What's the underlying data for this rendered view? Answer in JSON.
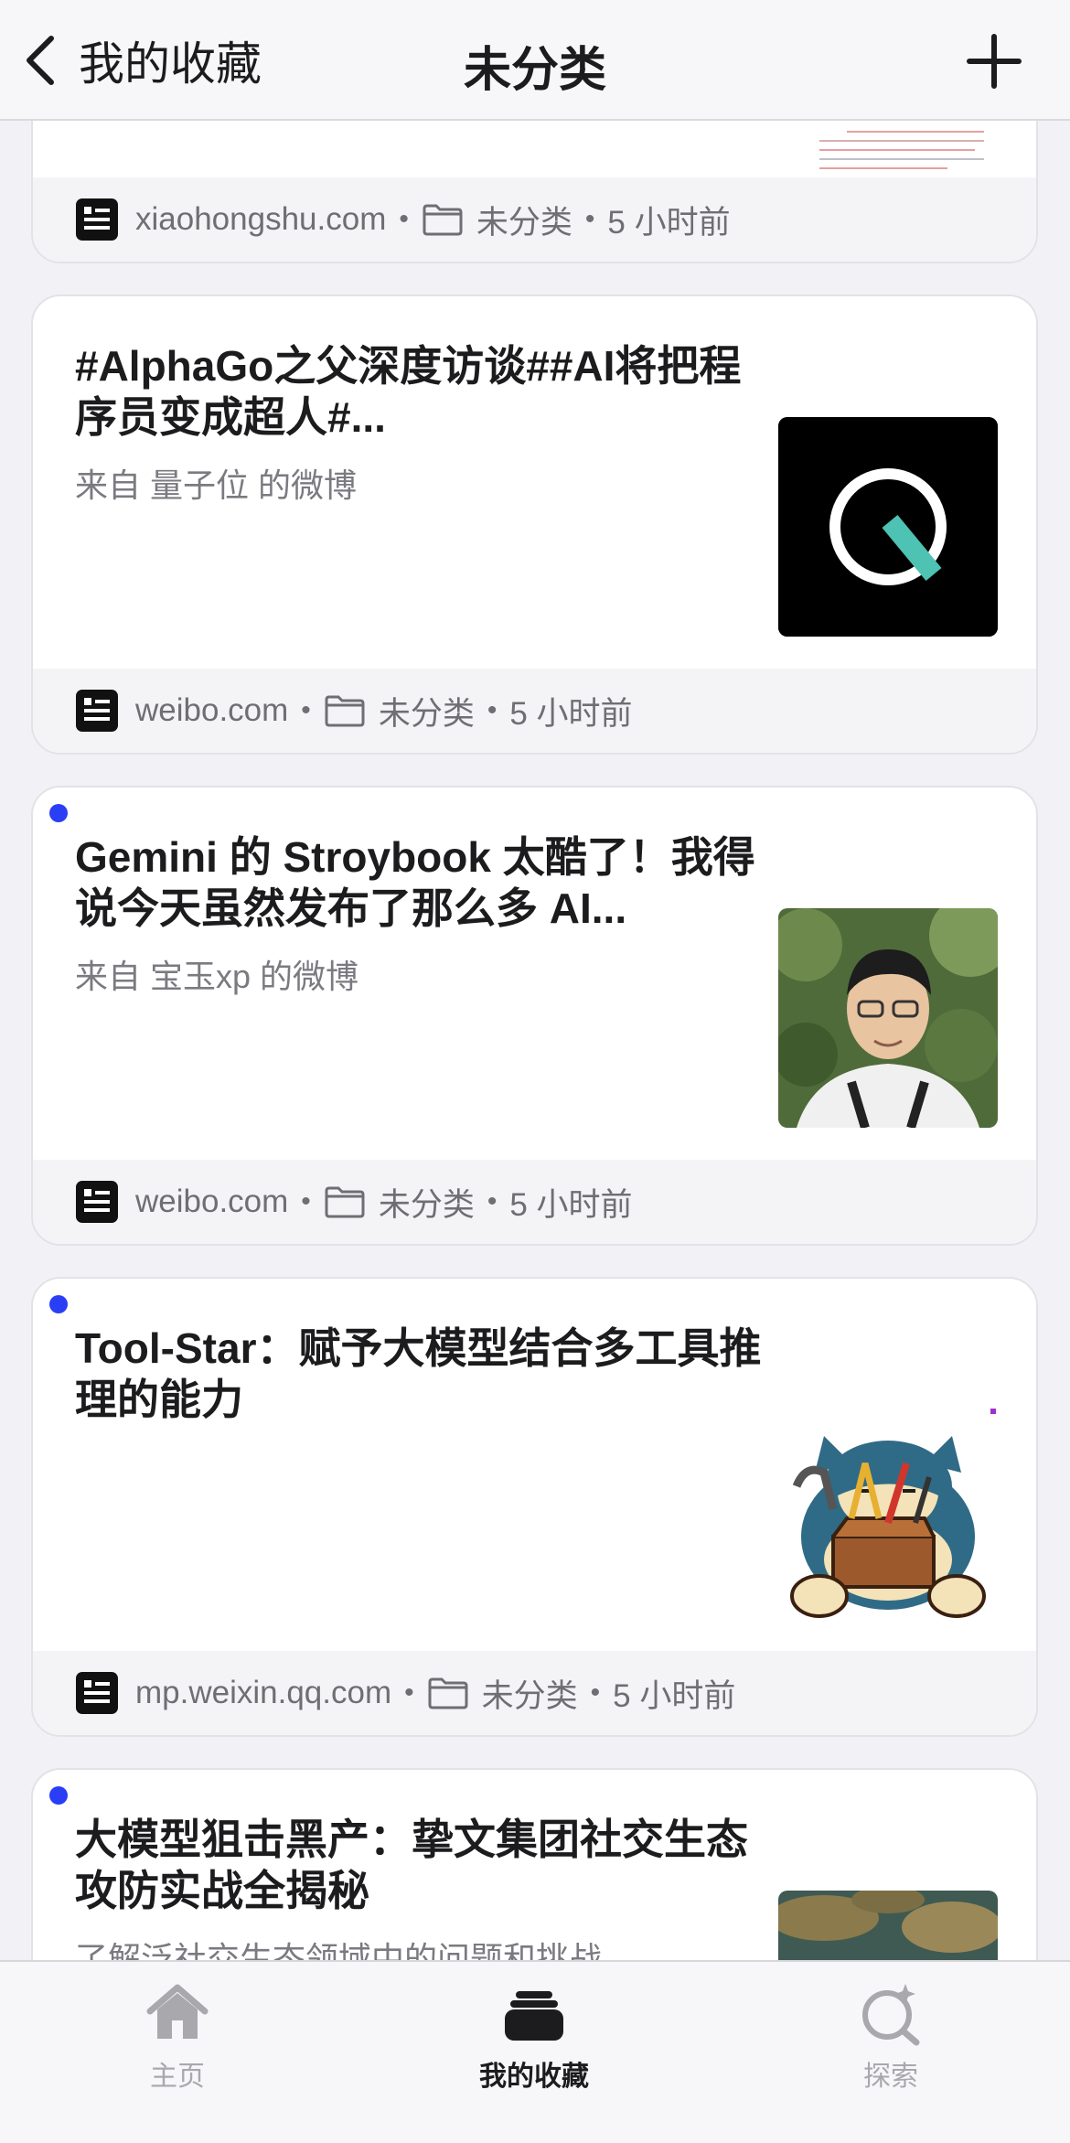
{
  "header": {
    "back_label": "我的收藏",
    "title": "未分类"
  },
  "cards": [
    {
      "title": "",
      "subtitle": "",
      "site": "xiaohongshu.com",
      "folder": "未分类",
      "time": "5 小时前"
    },
    {
      "title": "#AlphaGo之父深度访谈##AI将把程序员变成超人#...",
      "subtitle": "来自 量子位 的微博",
      "site": "weibo.com",
      "folder": "未分类",
      "time": "5 小时前"
    },
    {
      "title": "Gemini 的 Stroybook 太酷了！我得说今天虽然发布了那么多 AI...",
      "subtitle": "来自 宝玉xp 的微博",
      "site": "weibo.com",
      "folder": "未分类",
      "time": "5 小时前"
    },
    {
      "title": "Tool-Star：赋予大模型结合多工具推理的能力",
      "subtitle": "",
      "site": "mp.weixin.qq.com",
      "folder": "未分类",
      "time": "5 小时前"
    },
    {
      "title": "大模型狙击黑产：挚文集团社交生态攻防实战全揭秘",
      "subtitle": "了解泛社交生态领域中的问题和挑战",
      "site": "",
      "folder": "",
      "time": ""
    }
  ],
  "separator": "•",
  "tabs": [
    {
      "label": "主页",
      "icon": "home-icon"
    },
    {
      "label": "我的收藏",
      "icon": "collection-icon"
    },
    {
      "label": "探索",
      "icon": "explore-icon"
    }
  ],
  "colors": {
    "unread": "#2a3ef5",
    "background": "#f2f2f6",
    "card": "#ffffff"
  }
}
